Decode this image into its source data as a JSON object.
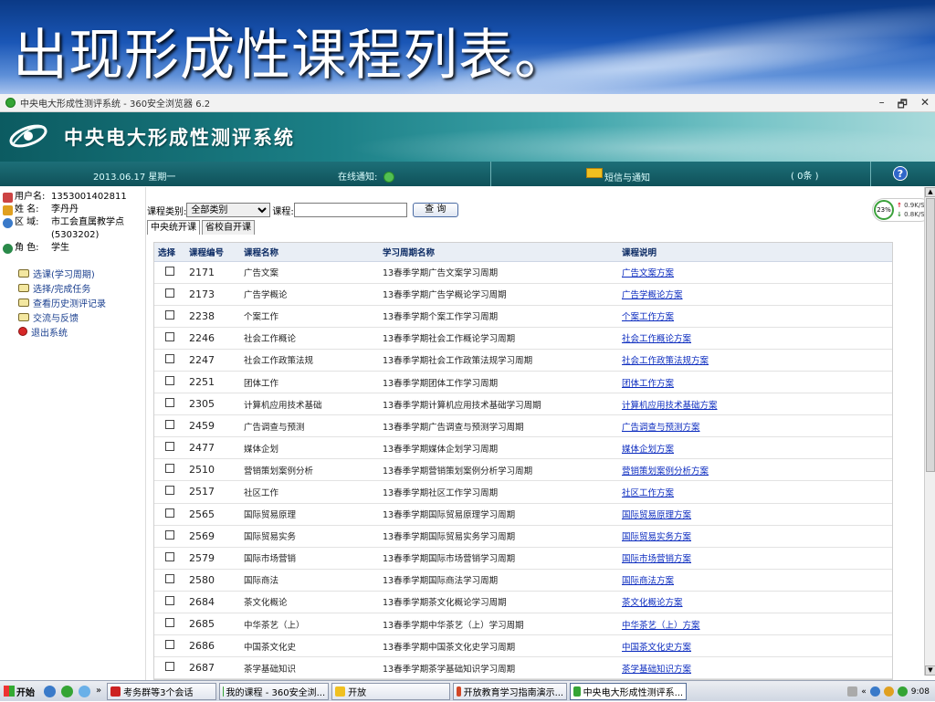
{
  "slide": {
    "title": "出现形成性课程列表。"
  },
  "browser": {
    "title": "中央电大形成性测评系统 - 360安全浏览器 6.2",
    "controls": [
      "–",
      "🗗",
      "✕"
    ]
  },
  "app": {
    "title": "中央电大形成性测评系统"
  },
  "status": {
    "date": "2013.06.17 星期一",
    "notice_label": "在线通知:",
    "sms_label": "短信与通知",
    "sms_count": "( 0条 )",
    "help": "?"
  },
  "user": {
    "username_label": "用户名:",
    "username": "1353001402811",
    "name_label": "姓  名:",
    "name": "李丹丹",
    "area_label": "区  域:",
    "area": "市工会直属教学点(5303202)",
    "role_label": "角  色:",
    "role": "学生"
  },
  "menu": [
    {
      "label": "选课(学习周期)"
    },
    {
      "label": "选择/完成任务"
    },
    {
      "label": "查看历史测评记录"
    },
    {
      "label": "交流与反馈"
    },
    {
      "label": "退出系统"
    }
  ],
  "filter": {
    "category_label": "课程类别:",
    "category_value": "全部类别",
    "course_label": "课程:",
    "course_value": "",
    "query_button": "查 询"
  },
  "tabs": [
    "中央统开课",
    "省校自开课"
  ],
  "table": {
    "headers": [
      "选择",
      "课程编号",
      "课程名称",
      "学习周期名称",
      "课程说明"
    ],
    "rows": [
      {
        "code": "2171",
        "name": "广告文案",
        "period": "13春季学期广告文案学习周期",
        "desc": "广告文案方案"
      },
      {
        "code": "2173",
        "name": "广告学概论",
        "period": "13春季学期广告学概论学习周期",
        "desc": "广告学概论方案"
      },
      {
        "code": "2238",
        "name": "个案工作",
        "period": "13春季学期个案工作学习周期",
        "desc": "个案工作方案"
      },
      {
        "code": "2246",
        "name": "社会工作概论",
        "period": "13春季学期社会工作概论学习周期",
        "desc": "社会工作概论方案"
      },
      {
        "code": "2247",
        "name": "社会工作政策法规",
        "period": "13春季学期社会工作政策法规学习周期",
        "desc": "社会工作政策法规方案"
      },
      {
        "code": "2251",
        "name": "团体工作",
        "period": "13春季学期团体工作学习周期",
        "desc": "团体工作方案"
      },
      {
        "code": "2305",
        "name": "计算机应用技术基础",
        "period": "13春季学期计算机应用技术基础学习周期",
        "desc": "计算机应用技术基础方案"
      },
      {
        "code": "2459",
        "name": "广告调查与预测",
        "period": "13春季学期广告调查与预测学习周期",
        "desc": "广告调查与预测方案"
      },
      {
        "code": "2477",
        "name": "媒体企划",
        "period": "13春季学期媒体企划学习周期",
        "desc": "媒体企划方案"
      },
      {
        "code": "2510",
        "name": "营销策划案例分析",
        "period": "13春季学期营销策划案例分析学习周期",
        "desc": "营销策划案例分析方案"
      },
      {
        "code": "2517",
        "name": "社区工作",
        "period": "13春季学期社区工作学习周期",
        "desc": "社区工作方案"
      },
      {
        "code": "2565",
        "name": "国际贸易原理",
        "period": "13春季学期国际贸易原理学习周期",
        "desc": "国际贸易原理方案"
      },
      {
        "code": "2569",
        "name": "国际贸易实务",
        "period": "13春季学期国际贸易实务学习周期",
        "desc": "国际贸易实务方案"
      },
      {
        "code": "2579",
        "name": "国际市场营销",
        "period": "13春季学期国际市场营销学习周期",
        "desc": "国际市场营销方案"
      },
      {
        "code": "2580",
        "name": "国际商法",
        "period": "13春季学期国际商法学习周期",
        "desc": "国际商法方案"
      },
      {
        "code": "2684",
        "name": "茶文化概论",
        "period": "13春季学期茶文化概论学习周期",
        "desc": "茶文化概论方案"
      },
      {
        "code": "2685",
        "name": "中华茶艺（上）",
        "period": "13春季学期中华茶艺（上）学习周期",
        "desc": "中华茶艺（上）方案"
      },
      {
        "code": "2686",
        "name": "中国茶文化史",
        "period": "13春季学期中国茶文化史学习周期",
        "desc": "中国茶文化史方案"
      },
      {
        "code": "2687",
        "name": "茶学基础知识",
        "period": "13春季学期茶学基础知识学习周期",
        "desc": "茶学基础知识方案"
      }
    ]
  },
  "net": {
    "percent": "23%",
    "up": "0.9K/S",
    "down": "0.8K/S"
  },
  "taskbar": {
    "start": "开始",
    "chevron": "»",
    "tasks": [
      "考务群等3个会话",
      "我的课程 - 360安全浏...",
      "开放",
      "开放教育学习指南演示...",
      "中央电大形成性测评系..."
    ],
    "tray_chevron": "«",
    "time": "9:08"
  },
  "colors": {
    "banner": "#1b7f86",
    "link": "#0b2bbf",
    "header_text": "#0c2b64"
  }
}
